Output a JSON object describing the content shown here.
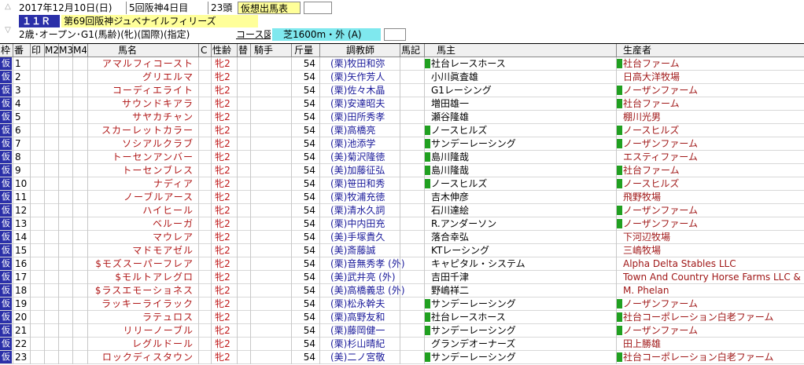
{
  "header": {
    "date": "2017年12月10日(日)",
    "meeting": "5回阪神4日目",
    "field_size": "23頭",
    "status": "仮想出馬表",
    "race_no": "１１Ｒ",
    "race_name": "第69回阪神ジュベナイルフィリーズ",
    "conditions": "2歳･オープン･G1(馬齢)(牝)(国際)(指定)",
    "course_label": "コース図",
    "course": "芝1600m・外 (A)"
  },
  "columns": {
    "waku": "枠",
    "ban": "番",
    "mark": "印",
    "m2": "M2",
    "m3": "M3",
    "m4": "M4",
    "horse": "馬名",
    "c": "C",
    "sexage": "性齢",
    "sub": "替",
    "jockey": "騎手",
    "weight": "斤量",
    "trainer": "調教師",
    "note": "馬記",
    "owner": "馬主",
    "breeder": "生産者"
  },
  "entries": [
    {
      "waku": "仮",
      "ban": "1",
      "horse": "アマルフィコースト",
      "sex": "牝2",
      "wt": "54",
      "trainer": "(栗)牧田和弥",
      "owner": "社台レースホース",
      "owner_mark": true,
      "breeder": "社台ファーム",
      "breeder_mark": true
    },
    {
      "waku": "仮",
      "ban": "2",
      "horse": "グリエルマ",
      "sex": "牝2",
      "wt": "54",
      "trainer": "(栗)矢作芳人",
      "owner": "小川眞査雄",
      "owner_mark": false,
      "breeder": "日高大洋牧場",
      "breeder_mark": false
    },
    {
      "waku": "仮",
      "ban": "3",
      "horse": "コーディエライト",
      "sex": "牝2",
      "wt": "54",
      "trainer": "(栗)佐々木晶",
      "owner": "G1レーシング",
      "owner_mark": false,
      "breeder": "ノーザンファーム",
      "breeder_mark": true
    },
    {
      "waku": "仮",
      "ban": "4",
      "horse": "サウンドキアラ",
      "sex": "牝2",
      "wt": "54",
      "trainer": "(栗)安達昭夫",
      "owner": "増田雄一",
      "owner_mark": false,
      "breeder": "社台ファーム",
      "breeder_mark": true
    },
    {
      "waku": "仮",
      "ban": "5",
      "horse": "サヤカチャン",
      "sex": "牝2",
      "wt": "54",
      "trainer": "(栗)田所秀孝",
      "owner": "瀬谷隆雄",
      "owner_mark": false,
      "breeder": "棚川光男",
      "breeder_mark": false
    },
    {
      "waku": "仮",
      "ban": "6",
      "horse": "スカーレットカラー",
      "sex": "牝2",
      "wt": "54",
      "trainer": "(栗)高橋亮",
      "owner": "ノースヒルズ",
      "owner_mark": true,
      "breeder": "ノースヒルズ",
      "breeder_mark": true
    },
    {
      "waku": "仮",
      "ban": "7",
      "horse": "ソシアルクラブ",
      "sex": "牝2",
      "wt": "54",
      "trainer": "(栗)池添学",
      "owner": "サンデーレーシング",
      "owner_mark": true,
      "breeder": "ノーザンファーム",
      "breeder_mark": true
    },
    {
      "waku": "仮",
      "ban": "8",
      "horse": "トーセンアンバー",
      "sex": "牝2",
      "wt": "54",
      "trainer": "(美)菊沢隆徳",
      "owner": "島川隆哉",
      "owner_mark": true,
      "breeder": "エスティファーム",
      "breeder_mark": false
    },
    {
      "waku": "仮",
      "ban": "9",
      "horse": "トーセンブレス",
      "sex": "牝2",
      "wt": "54",
      "trainer": "(美)加藤征弘",
      "owner": "島川隆哉",
      "owner_mark": true,
      "breeder": "社台ファーム",
      "breeder_mark": true
    },
    {
      "waku": "仮",
      "ban": "10",
      "horse": "ナディア",
      "sex": "牝2",
      "wt": "54",
      "trainer": "(栗)笹田和秀",
      "owner": "ノースヒルズ",
      "owner_mark": true,
      "breeder": "ノースヒルズ",
      "breeder_mark": true
    },
    {
      "waku": "仮",
      "ban": "11",
      "horse": "ノーブルアース",
      "sex": "牝2",
      "wt": "54",
      "trainer": "(栗)牧浦充徳",
      "owner": "吉木伸彦",
      "owner_mark": false,
      "breeder": "飛野牧場",
      "breeder_mark": false
    },
    {
      "waku": "仮",
      "ban": "12",
      "horse": "ハイヒール",
      "sex": "牝2",
      "wt": "54",
      "trainer": "(栗)清水久詞",
      "owner": "石川達絵",
      "owner_mark": false,
      "breeder": "ノーザンファーム",
      "breeder_mark": true
    },
    {
      "waku": "仮",
      "ban": "13",
      "horse": "ベルーガ",
      "sex": "牝2",
      "wt": "54",
      "trainer": "(栗)中内田充",
      "owner": "R.アンダーソン",
      "owner_mark": false,
      "breeder": "ノーザンファーム",
      "breeder_mark": true
    },
    {
      "waku": "仮",
      "ban": "14",
      "horse": "マウレア",
      "sex": "牝2",
      "wt": "54",
      "trainer": "(美)手塚貴久",
      "owner": "落合幸弘",
      "owner_mark": false,
      "breeder": "下河辺牧場",
      "breeder_mark": false
    },
    {
      "waku": "仮",
      "ban": "15",
      "horse": "マドモアゼル",
      "sex": "牝2",
      "wt": "54",
      "trainer": "(美)斎藤誠",
      "owner": "KTレーシング",
      "owner_mark": false,
      "breeder": "三嶋牧場",
      "breeder_mark": false
    },
    {
      "waku": "仮",
      "ban": "16",
      "horse": "$モズスーパーフレア",
      "sex": "牝2",
      "wt": "54",
      "trainer": "(栗)音無秀孝 (外)",
      "owner": "キャピタル・システム",
      "owner_mark": false,
      "breeder": "Alpha Delta Stables LLC",
      "breeder_mark": false
    },
    {
      "waku": "仮",
      "ban": "17",
      "horse": "$モルトアレグロ",
      "sex": "牝2",
      "wt": "54",
      "trainer": "(美)武井亮   (外)",
      "owner": "吉田千津",
      "owner_mark": false,
      "breeder": "Town And Country Horse Farms LLC & F",
      "breeder_mark": false
    },
    {
      "waku": "仮",
      "ban": "18",
      "horse": "$ラスエモーショネス",
      "sex": "牝2",
      "wt": "54",
      "trainer": "(美)高橋義忠 (外)",
      "owner": "野嶋祥二",
      "owner_mark": false,
      "breeder": "M. Phelan",
      "breeder_mark": false
    },
    {
      "waku": "仮",
      "ban": "19",
      "horse": "ラッキーライラック",
      "sex": "牝2",
      "wt": "54",
      "trainer": "(栗)松永幹夫",
      "owner": "サンデーレーシング",
      "owner_mark": true,
      "breeder": "ノーザンファーム",
      "breeder_mark": true
    },
    {
      "waku": "仮",
      "ban": "20",
      "horse": "ラテュロス",
      "sex": "牝2",
      "wt": "54",
      "trainer": "(栗)高野友和",
      "owner": "社台レースホース",
      "owner_mark": true,
      "breeder": "社台コーポレーション白老ファーム",
      "breeder_mark": true
    },
    {
      "waku": "仮",
      "ban": "21",
      "horse": "リリーノーブル",
      "sex": "牝2",
      "wt": "54",
      "trainer": "(栗)藤岡健一",
      "owner": "サンデーレーシング",
      "owner_mark": true,
      "breeder": "ノーザンファーム",
      "breeder_mark": true
    },
    {
      "waku": "仮",
      "ban": "22",
      "horse": "レグルドール",
      "sex": "牝2",
      "wt": "54",
      "trainer": "(栗)杉山晴紀",
      "owner": "グランデオーナーズ",
      "owner_mark": false,
      "breeder": "田上勝雄",
      "breeder_mark": false
    },
    {
      "waku": "仮",
      "ban": "23",
      "horse": "ロックディスタウン",
      "sex": "牝2",
      "wt": "54",
      "trainer": "(美)二ノ宮敬",
      "owner": "サンデーレーシング",
      "owner_mark": true,
      "breeder": "社台コーポレーション白老ファーム",
      "breeder_mark": true
    }
  ],
  "colors": {
    "waku_bg": "#2a2fa8",
    "race_bg": "#ffff99",
    "race_no_bg": "#2a2fa8",
    "course_bg": "#7fe8ee",
    "horse_text": "#b01818",
    "trainer_text": "#1a1a9a",
    "mark_bg": "#20a020"
  },
  "icons": {
    "scroll_up": "chevron-up-icon",
    "scroll_down": "chevron-down-icon"
  }
}
